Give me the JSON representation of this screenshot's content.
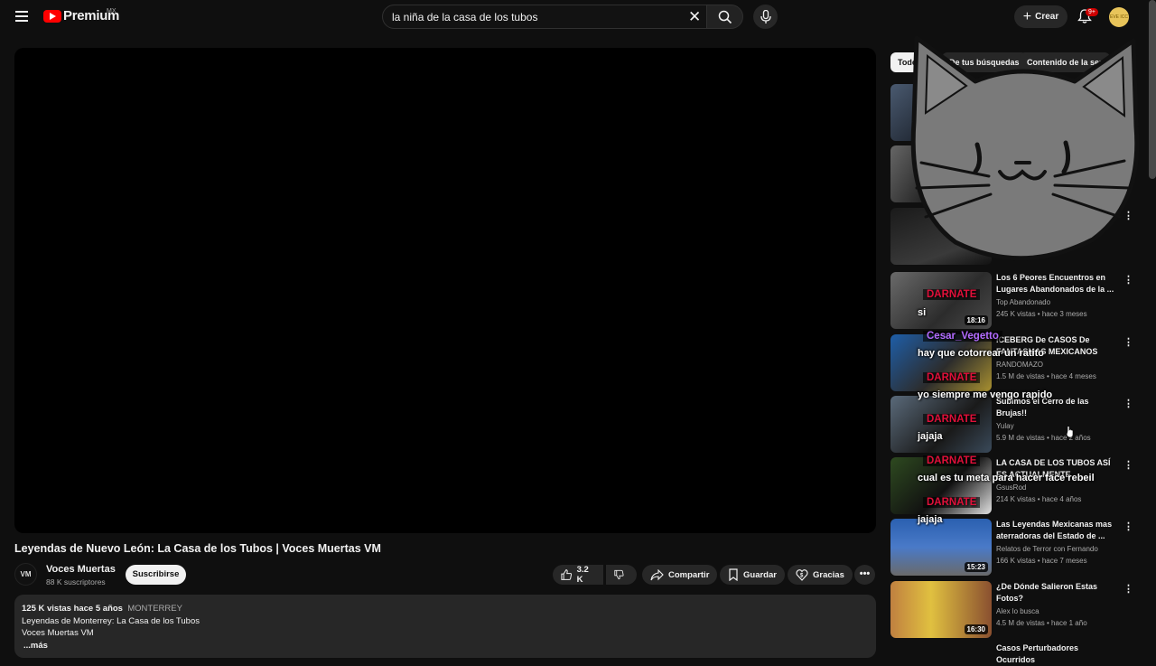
{
  "topbar": {
    "logo_text": "Premium",
    "logo_region": "MX",
    "search_query": "la niña de la casa de los tubos",
    "create_label": "Crear",
    "notif_count": "9+",
    "avatar_text": "EVE ICC"
  },
  "video": {
    "title": "Leyendas de Nuevo León: La Casa de los Tubos | Voces Muertas VM",
    "channel": "Voces Muertas",
    "channel_avatar": "VM",
    "subscribers": "88 K suscriptores",
    "subscribe_label": "Suscribirse",
    "likes": "3.2 K",
    "share_label": "Compartir",
    "save_label": "Guardar",
    "thanks_label": "Gracias",
    "description": {
      "views_date": "125 K vistas  hace 5 años",
      "tag": "MONTERREY",
      "line1": "Leyendas de Monterrey: La Casa de los Tubos",
      "line2": "Voces Muertas VM",
      "more": "...más"
    }
  },
  "chips": [
    {
      "label": "Todos"
    },
    {
      "label": "De tus búsquedas"
    },
    {
      "label": "Contenido de la serie"
    }
  ],
  "recommendations": [
    {
      "title": "",
      "channel": "",
      "meta": "",
      "duration": ""
    },
    {
      "title": "",
      "channel": "",
      "meta": "",
      "duration": ""
    },
    {
      "title": "",
      "channel": "",
      "meta": "",
      "duration": ""
    },
    {
      "title": "Los 6 Peores Encuentros en Lugares Abandonados de la ...",
      "channel": "Top Abandonado",
      "meta": "245 K vistas • hace 3 meses",
      "duration": "18:16"
    },
    {
      "title": "ICEBERG De CASOS De FANTASMAS MEXICANOS",
      "channel": "RANDOMAZO",
      "meta": "1.5 M de vistas • hace 4 meses",
      "duration": ""
    },
    {
      "title": "Subimos el Cerro de las Brujas!!",
      "channel": "Yulay",
      "meta": "5.9 M de vistas • hace 2 años",
      "duration": ""
    },
    {
      "title": "LA CASA DE LOS TUBOS ASÍ ES ACTUALMENTE REMODELAD...",
      "channel": "GsusRod",
      "meta": "214 K vistas • hace 4 años",
      "duration": ""
    },
    {
      "title": "Las Leyendas Mexicanas mas aterradoras del Estado de ...",
      "channel": "Relatos de Terror con Fernando",
      "meta": "166 K vistas • hace 7 meses",
      "duration": "15:23"
    },
    {
      "title": "¿De Dónde Salieron Estas Fotos?",
      "channel": "Alex lo busca",
      "meta": "4.5 M de vistas • hace 1 año",
      "duration": "16:30"
    },
    {
      "title": "Casos Perturbadores Ocurridos",
      "channel": "",
      "meta": "",
      "duration": ""
    }
  ],
  "stream_overlay": {
    "messages": [
      {
        "user": "DARNATE",
        "text": "si"
      },
      {
        "user": "Cesar_Vegetto",
        "text": "hay que cotorrear un ratito"
      },
      {
        "user": "DARNATE",
        "text": "yo siempre me vengo rapido"
      },
      {
        "user": "DARNATE",
        "text": "jajaja"
      },
      {
        "user": "DARNATE",
        "text": "cual es tu meta para hacer face rebeil"
      },
      {
        "user": "DARNATE",
        "text": "jajaja"
      }
    ],
    "user_colors": {
      "DARNATE": "#e0103a",
      "Cesar_Vegetto": "#b36bff"
    }
  }
}
